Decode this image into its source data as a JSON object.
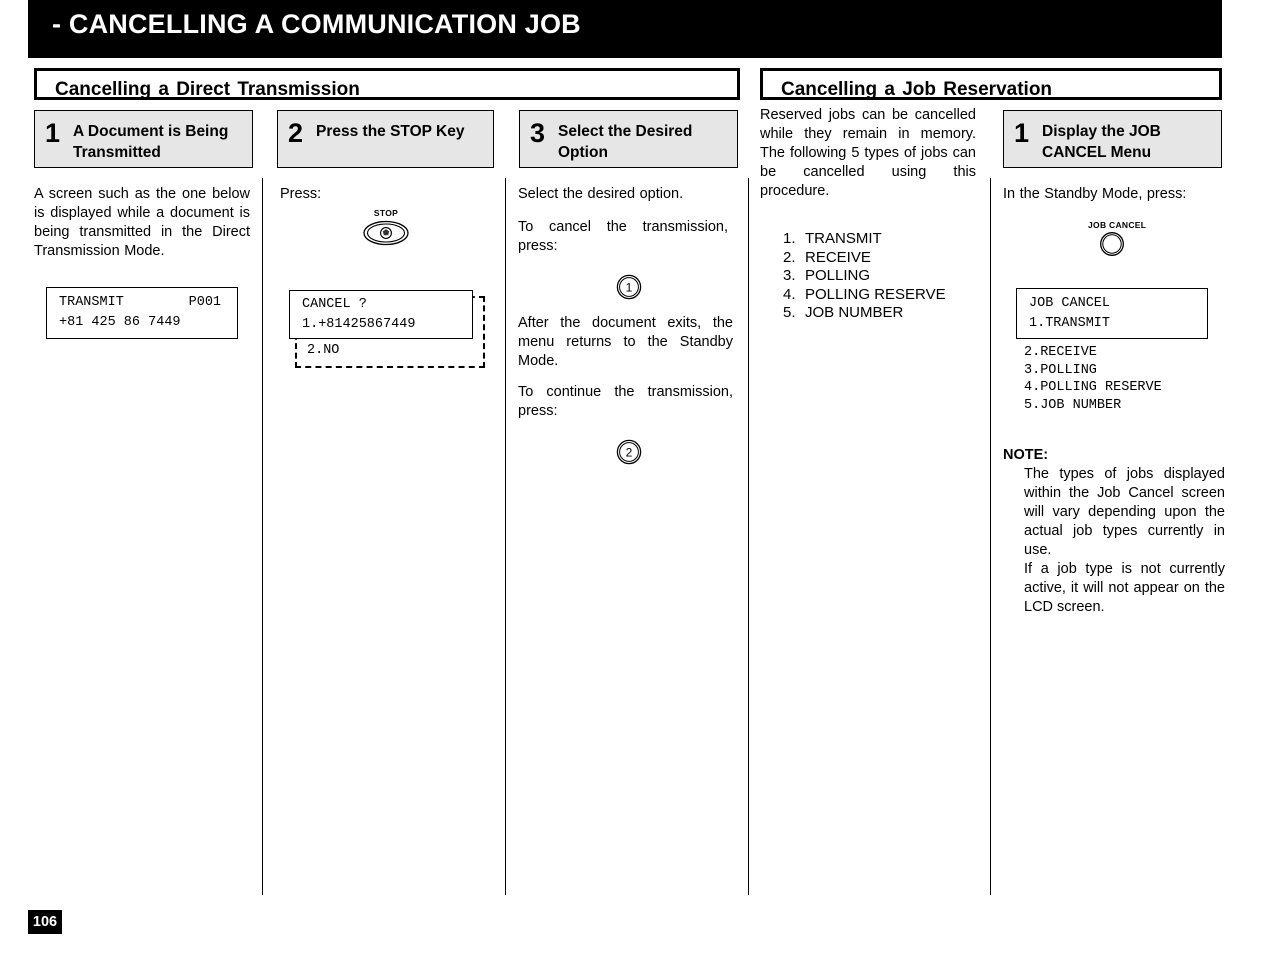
{
  "header": {
    "title": "- CANCELLING A COMMUNICATION JOB"
  },
  "page_number": "106",
  "sections": {
    "left": {
      "heading": "Cancelling a Direct Transmission",
      "steps": [
        {
          "number": "1",
          "title": "A Document is Being Transmitted",
          "body": "A screen such as the one below is displayed while a document is being transmitted in the Direct Transmission Mode.",
          "lcd": {
            "line1": "TRANSMIT        P001",
            "line2": "+81 425 86 7449"
          }
        },
        {
          "number": "2",
          "title": "Press the STOP Key",
          "body": "Press:",
          "key_label": "STOP",
          "key_icon": "stop-key-icon",
          "lcd": {
            "line1": "CANCEL ?",
            "line2": "1.+81425867449",
            "line3": "2.NO"
          }
        },
        {
          "number": "3",
          "title": "Select the Desired Option",
          "body1": "Select the desired option.",
          "body2": "To cancel the transmission, press:",
          "keypad1": "1",
          "body3": "After the document exits, the menu returns to the Standby Mode.",
          "body4": "To continue the transmission, press:",
          "keypad2": "2"
        }
      ]
    },
    "right": {
      "heading": "Cancelling a Job Reservation",
      "intro": "Reserved jobs can be cancelled while they remain in memory. The following 5 types of jobs can be cancelled using this procedure.",
      "job_types": [
        {
          "num": "1.",
          "label": "TRANSMIT"
        },
        {
          "num": "2.",
          "label": "RECEIVE"
        },
        {
          "num": "3.",
          "label": "POLLING"
        },
        {
          "num": "4.",
          "label": "POLLING RESERVE"
        },
        {
          "num": "5.",
          "label": "JOB NUMBER"
        }
      ],
      "step": {
        "number": "1",
        "title": "Display the JOB CANCEL Menu",
        "body": "In the Standby Mode, press:",
        "key_label": "JOB CANCEL",
        "key_icon": "job-cancel-key-icon",
        "lcd": {
          "line1": "JOB CANCEL",
          "line2": "1.TRANSMIT"
        },
        "lcd_extra": [
          "2.RECEIVE",
          "3.POLLING",
          "4.POLLING RESERVE",
          "5.JOB NUMBER"
        ]
      },
      "note": {
        "label": "NOTE:",
        "paragraph1": "The types of jobs displayed within the Job Cancel screen will vary depending upon the actual job types currently in use.",
        "paragraph2": "If a job type is not currently active, it will not appear on the LCD screen."
      }
    }
  },
  "colors": {
    "header_bar": "#000000",
    "header_text": "#ffffff",
    "step_head_fill": "#e6e6e6",
    "rule": "#000000"
  }
}
